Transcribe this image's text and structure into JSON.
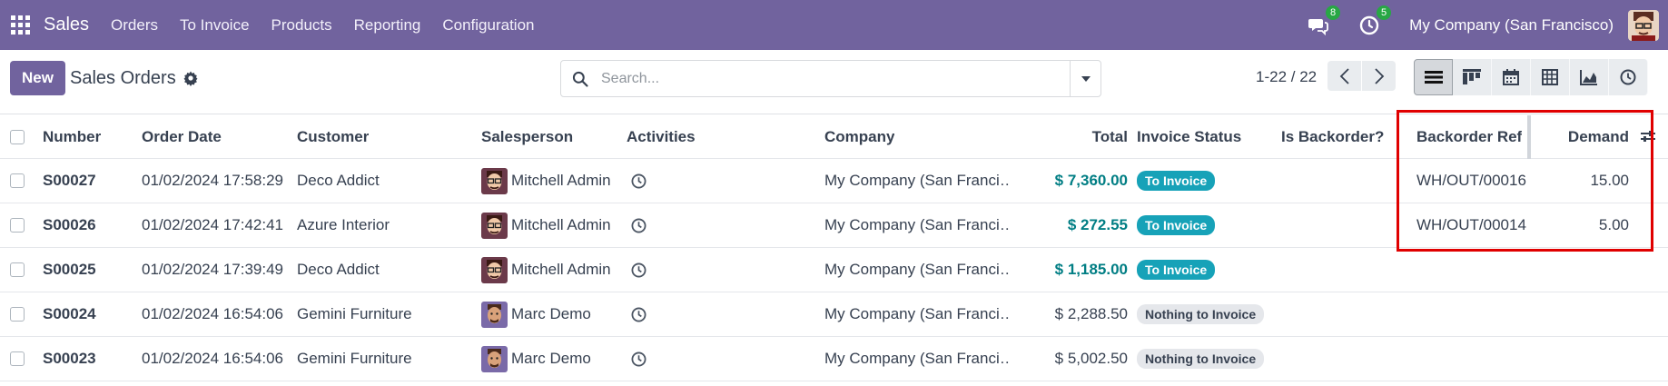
{
  "navbar": {
    "app_name": "Sales",
    "menu": [
      "Orders",
      "To Invoice",
      "Products",
      "Reporting",
      "Configuration"
    ],
    "messages_count": "8",
    "activities_count": "5",
    "company": "My Company (San Francisco)",
    "bg_color": "#71639e"
  },
  "control": {
    "new_label": "New",
    "title": "Sales Orders",
    "search_placeholder": "Search...",
    "pager": "1-22 / 22",
    "views": [
      "list-view-icon",
      "kanban-view-icon",
      "calendar-view-icon",
      "pivot-view-icon",
      "graph-view-icon",
      "activity-view-icon"
    ]
  },
  "table": {
    "headers": {
      "number": "Number",
      "order_date": "Order Date",
      "customer": "Customer",
      "salesperson": "Salesperson",
      "activities": "Activities",
      "company": "Company",
      "total": "Total",
      "invoice_status": "Invoice Status",
      "is_backorder": "Is Backorder?",
      "backorder_ref": "Backorder Ref",
      "demand": "Demand"
    },
    "rows": [
      {
        "number": "S00027",
        "date": "01/02/2024 17:58:29",
        "customer": "Deco Addict",
        "salesperson": "Mitchell Admin",
        "company": "My Company (San Franci…",
        "total": "$ 7,360.00",
        "status": "To Invoice",
        "backorder_ref": "WH/OUT/00016",
        "demand": "15.00"
      },
      {
        "number": "S00026",
        "date": "01/02/2024 17:42:41",
        "customer": "Azure Interior",
        "salesperson": "Mitchell Admin",
        "company": "My Company (San Franci…",
        "total": "$ 272.55",
        "status": "To Invoice",
        "backorder_ref": "WH/OUT/00014",
        "demand": "5.00"
      },
      {
        "number": "S00025",
        "date": "01/02/2024 17:39:49",
        "customer": "Deco Addict",
        "salesperson": "Mitchell Admin",
        "company": "My Company (San Franci…",
        "total": "$ 1,185.00",
        "status": "To Invoice",
        "backorder_ref": "",
        "demand": ""
      },
      {
        "number": "S00024",
        "date": "01/02/2024 16:54:06",
        "customer": "Gemini Furniture",
        "salesperson": "Marc Demo",
        "company": "My Company (San Franci…",
        "total": "$ 2,288.50",
        "status": "Nothing to Invoice",
        "backorder_ref": "",
        "demand": ""
      },
      {
        "number": "S00023",
        "date": "01/02/2024 16:54:06",
        "customer": "Gemini Furniture",
        "salesperson": "Marc Demo",
        "company": "My Company (San Franci…",
        "total": "$ 5,002.50",
        "status": "Nothing to Invoice",
        "backorder_ref": "",
        "demand": ""
      }
    ]
  }
}
